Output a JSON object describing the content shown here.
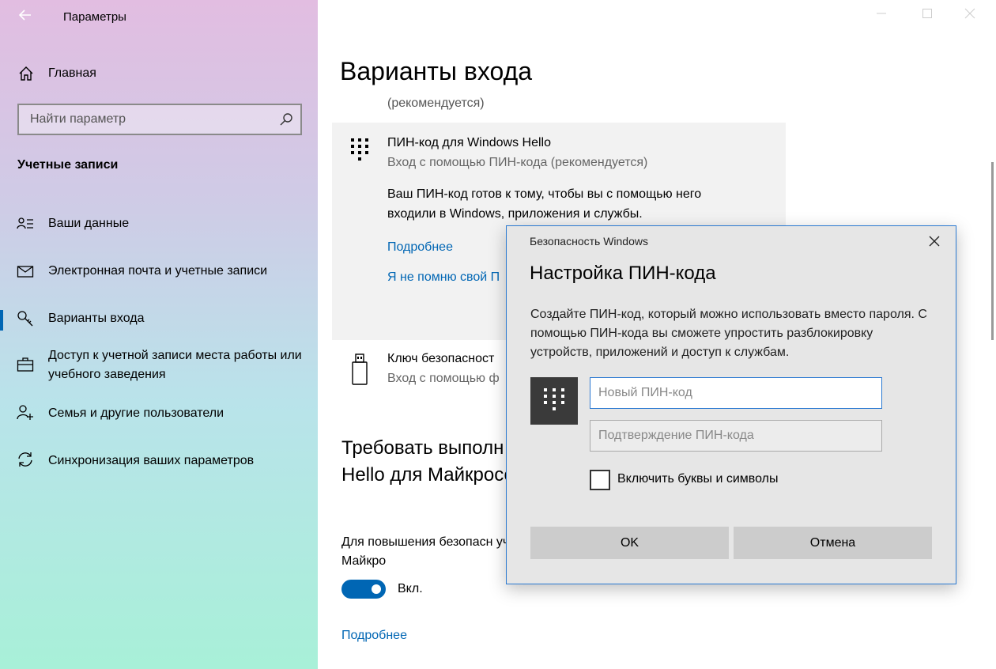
{
  "window": {
    "app_title": "Параметры"
  },
  "sidebar": {
    "home_label": "Главная",
    "search_placeholder": "Найти параметр",
    "section_title": "Учетные записи",
    "items": [
      {
        "label": "Ваши данные",
        "icon": "person-card-icon"
      },
      {
        "label": "Электронная почта и учетные записи",
        "icon": "mail-icon"
      },
      {
        "label": "Варианты входа",
        "icon": "key-icon",
        "active": true
      },
      {
        "label": "Доступ к учетной записи места работы или учебного заведения",
        "icon": "briefcase-icon"
      },
      {
        "label": "Семья и другие пользователи",
        "icon": "person-add-icon"
      },
      {
        "label": "Синхронизация ваших параметров",
        "icon": "sync-icon"
      }
    ]
  },
  "main": {
    "title": "Варианты входа",
    "recommended": "(рекомендуется)",
    "pin": {
      "title": "ПИН-код для Windows Hello",
      "subtitle": "Вход с помощью ПИН-кода (рекомендуется)",
      "description": "Ваш ПИН-код готов к тому, чтобы вы с помощью него входили в Windows, приложения и службы.",
      "link_more": "Подробнее",
      "link_forgot": "Я не помню свой П"
    },
    "security_key": {
      "title": "Ключ безопасност",
      "subtitle": "Вход с помощью ф"
    },
    "require": {
      "title": "Требовать выполн Windows Hello для Майкрософт",
      "description": "Для повышения безопасн учетных записей Майкро",
      "toggle_label": "Вкл.",
      "toggle_on": true,
      "link_more": "Подробнее"
    }
  },
  "dialog": {
    "caption": "Безопасность Windows",
    "title": "Настройка ПИН-кода",
    "description": "Создайте ПИН-код, который можно использовать вместо пароля. С помощью ПИН-кода вы сможете упростить разблокировку устройств, приложений и доступ к службам.",
    "new_pin_placeholder": "Новый ПИН-код",
    "confirm_pin_placeholder": "Подтверждение ПИН-кода",
    "checkbox_label": "Включить буквы и символы",
    "checkbox_checked": false,
    "ok_label": "OK",
    "cancel_label": "Отмена"
  },
  "colors": {
    "accent": "#0066b4",
    "dialog_border": "#2b79d1"
  }
}
